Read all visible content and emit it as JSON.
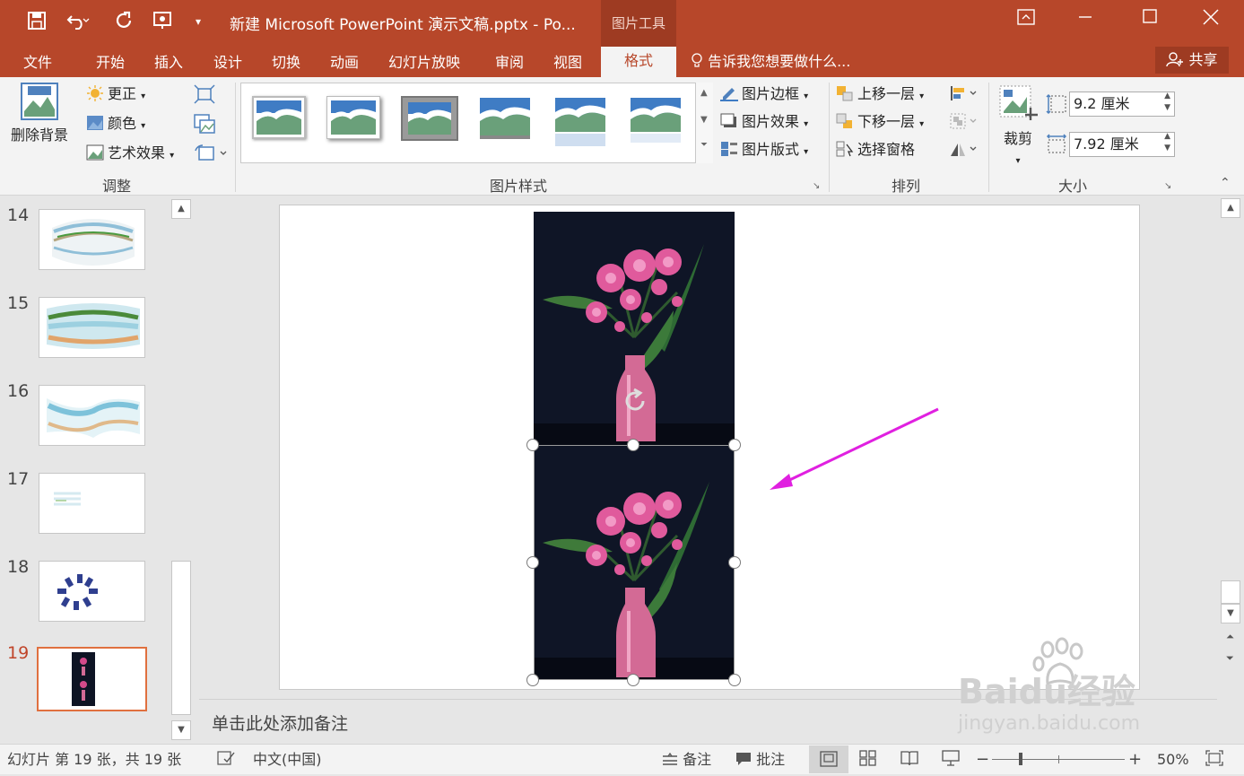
{
  "titlebar": {
    "title": "新建 Microsoft PowerPoint 演示文稿.pptx - Po...",
    "tool_tab": "图片工具",
    "save_icon": "save-icon",
    "undo_icon": "undo-icon",
    "redo_icon": "redo-icon"
  },
  "tabs": [
    "文件",
    "开始",
    "插入",
    "设计",
    "切换",
    "动画",
    "幻灯片放映",
    "审阅",
    "视图",
    "格式"
  ],
  "active_tab": "格式",
  "tellme": "告诉我您想要做什么...",
  "share": "共享",
  "ribbon": {
    "adjust": {
      "remove_bg": "删除背景",
      "correct": "更正",
      "color": "颜色",
      "artistic": "艺术效果",
      "label": "调整"
    },
    "styles": {
      "border": "图片边框",
      "effects": "图片效果",
      "layout": "图片版式",
      "label": "图片样式"
    },
    "arrange": {
      "bring_forward": "上移一层",
      "send_backward": "下移一层",
      "selection_pane": "选择窗格",
      "label": "排列"
    },
    "size": {
      "crop": "裁剪",
      "height": "9.2 厘米",
      "width": "7.92 厘米",
      "label": "大小"
    }
  },
  "thumbnails": [
    {
      "num": "14"
    },
    {
      "num": "15"
    },
    {
      "num": "16"
    },
    {
      "num": "17"
    },
    {
      "num": "18"
    },
    {
      "num": "19"
    }
  ],
  "notes_placeholder": "单击此处添加备注",
  "status": {
    "slide_info": "幻灯片 第 19 张，共 19 张",
    "language": "中文(中国)",
    "notes": "备注",
    "comments": "批注",
    "zoom": "50%"
  },
  "watermark": {
    "brand": "Baidu经验",
    "url": "jingyan.baidu.com"
  },
  "colors": {
    "accent": "#b7472a",
    "arrow": "#e020e0",
    "selected_thumb": "#e0703f"
  }
}
